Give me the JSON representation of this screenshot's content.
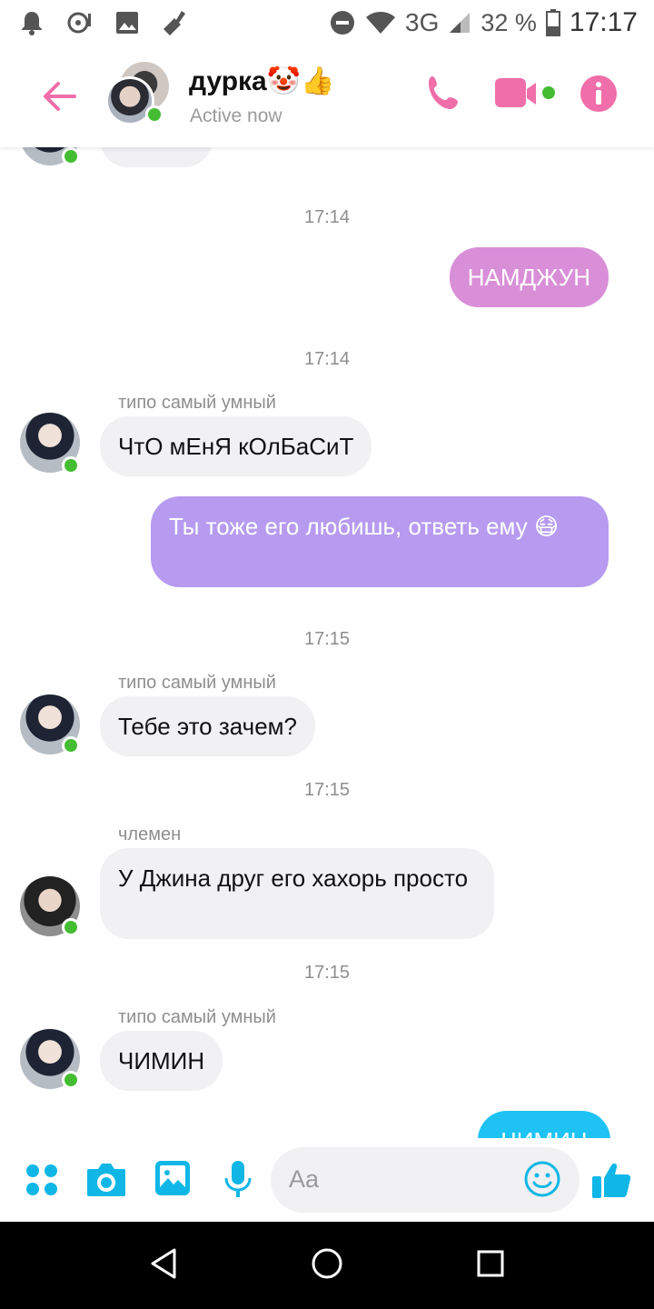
{
  "status_bar": {
    "network": "3G",
    "battery": "32 %",
    "time": "17:17"
  },
  "header": {
    "title": "дурка🤡👍",
    "subtitle": "Active now"
  },
  "messages": {
    "stamp1": "17:14",
    "msg1": "НАМДЖУН",
    "stamp2": "17:14",
    "sender2": "типо самый умный",
    "msg2": "ЧтО мЕнЯ кОлБаСиТ",
    "msg3": "Ты тоже его любишь, ответь ему 😷",
    "stamp3": "17:15",
    "sender4": "типо самый умный",
    "msg4": "Тебе это зачем?",
    "stamp4": "17:15",
    "sender5": "члемен",
    "msg5": "У Джина друг его хахорь просто",
    "stamp5": "17:15",
    "sender6": "типо самый умный",
    "msg6": "ЧИМИН",
    "msg7": "ЧИМИН"
  },
  "composer": {
    "placeholder": "Aa"
  },
  "icons": {
    "accent": "#f06ea9",
    "composer_accent": "#10b7e6"
  }
}
